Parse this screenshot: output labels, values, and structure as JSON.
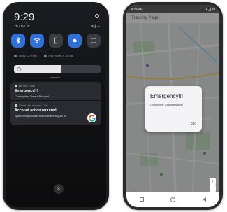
{
  "left_phone": {
    "clock": "9:29",
    "date": "Thu Jan 20",
    "status_icons": "⊞ ∥ ▭",
    "quick_toggles": [
      {
        "icon": "bluetooth-icon",
        "state": "on"
      },
      {
        "icon": "wifi-icon",
        "state": "on"
      },
      {
        "icon": "flashlight-icon",
        "state": "off"
      },
      {
        "icon": "notification-bell-icon",
        "state": "on"
      },
      {
        "icon": "screenshot-icon",
        "state": "off"
      }
    ],
    "usage": {
      "today": "Today 13.9 MB",
      "this_month": "This month 1.33 GB"
    },
    "brightness_level": 0.55,
    "notifications": [
      {
        "app": "tel_gps · now",
        "title": "Emergency!!!",
        "body": "Christopher Galant Bahayel"
      },
      {
        "app": "Gmail · No account · 1m",
        "title": "Account action required",
        "body": "kyanchris@student.telkomuniversity.ac.id"
      }
    ],
    "dismiss_label": "×"
  },
  "right_phone": {
    "status_time": "9:16 AM",
    "status_right": "▾ ◢ 88",
    "app_title": "Tracking Page",
    "dialog": {
      "title": "Emergency!!!",
      "message": "Christopher Galant Bahayel",
      "ok_label": "OK"
    },
    "zoom_in": "+",
    "zoom_out": "−",
    "map_brand": "Google"
  },
  "colors": {
    "toggle_active": "#2f6fd6",
    "toggle_inactive": "#3a3c42",
    "map_road": "#ffffff",
    "map_park": "#c8e6c9",
    "map_water": "#aadaff",
    "dialog_bg": "#f4f3f6"
  }
}
